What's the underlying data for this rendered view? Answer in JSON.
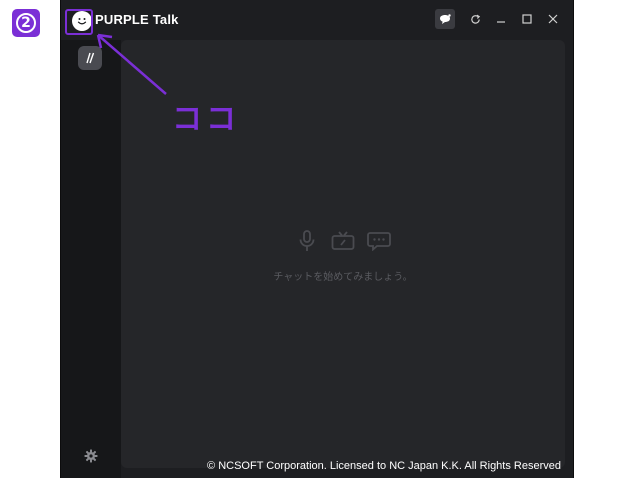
{
  "step": {
    "number": "2"
  },
  "window": {
    "title": "PURPLE Talk",
    "icons": {
      "logo": "smiley-logo-icon",
      "chat": "chat-bubble-icon",
      "refresh": "refresh-icon",
      "minimize": "minimize-icon",
      "maximize": "maximize-icon",
      "close": "close-icon"
    }
  },
  "sidebar": {
    "compose_icon": "pencil-icon",
    "settings_icon": "gear-icon"
  },
  "main": {
    "empty_state_icons": [
      "microphone-icon",
      "tv-icon",
      "chat-icon"
    ],
    "empty_text": "チャットを始めてみましょう。"
  },
  "footer": {
    "copyright": "© NCSOFT Corporation. Licensed to NC Japan K.K. All Rights Reserved"
  },
  "annotation": {
    "callout": "ココ",
    "color": "#7b2fd6"
  }
}
